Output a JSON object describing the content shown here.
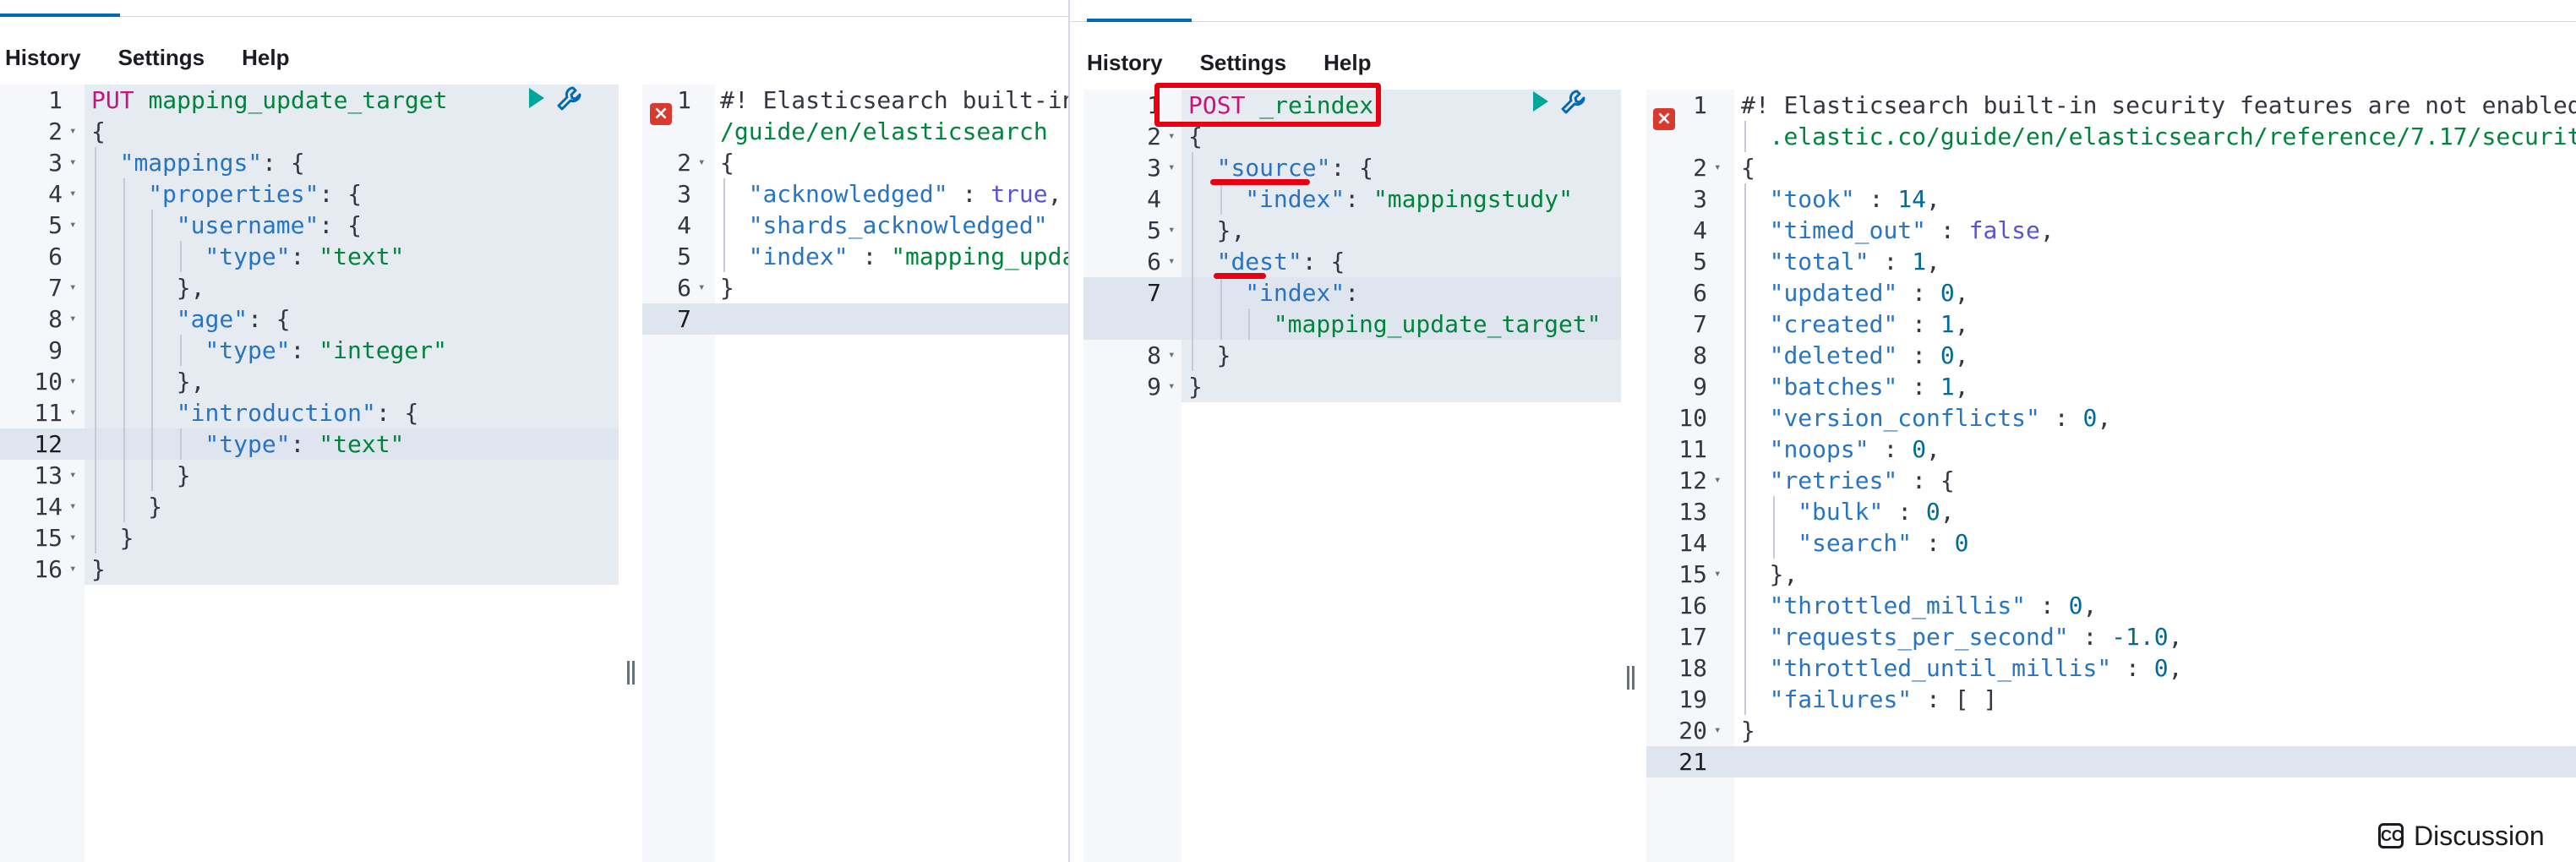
{
  "menu": {
    "history": "History",
    "settings": "Settings",
    "help": "Help"
  },
  "left_request": {
    "lines": [
      {
        "n": "1",
        "fold": false,
        "indent": 0,
        "html": [
          [
            "m",
            "PUT "
          ],
          [
            "u",
            "mapping_update_target"
          ]
        ]
      },
      {
        "n": "2",
        "fold": true,
        "indent": 0,
        "html": [
          [
            "p",
            "{"
          ]
        ]
      },
      {
        "n": "3",
        "fold": true,
        "indent": 1,
        "html": [
          [
            "k",
            "\"mappings\""
          ],
          [
            "p",
            ": {"
          ]
        ]
      },
      {
        "n": "4",
        "fold": true,
        "indent": 2,
        "html": [
          [
            "k",
            "\"properties\""
          ],
          [
            "p",
            ": {"
          ]
        ]
      },
      {
        "n": "5",
        "fold": true,
        "indent": 3,
        "html": [
          [
            "k",
            "\"username\""
          ],
          [
            "p",
            ": {"
          ]
        ]
      },
      {
        "n": "6",
        "fold": false,
        "indent": 4,
        "html": [
          [
            "k",
            "\"type\""
          ],
          [
            "p",
            ": "
          ],
          [
            "s",
            "\"text\""
          ]
        ]
      },
      {
        "n": "7",
        "fold": true,
        "indent": 3,
        "html": [
          [
            "p",
            "},"
          ]
        ]
      },
      {
        "n": "8",
        "fold": true,
        "indent": 3,
        "html": [
          [
            "k",
            "\"age\""
          ],
          [
            "p",
            ": {"
          ]
        ]
      },
      {
        "n": "9",
        "fold": false,
        "indent": 4,
        "html": [
          [
            "k",
            "\"type\""
          ],
          [
            "p",
            ": "
          ],
          [
            "s",
            "\"integer\""
          ]
        ]
      },
      {
        "n": "10",
        "fold": true,
        "indent": 3,
        "html": [
          [
            "p",
            "},"
          ]
        ]
      },
      {
        "n": "11",
        "fold": true,
        "indent": 3,
        "html": [
          [
            "k",
            "\"introduction\""
          ],
          [
            "p",
            ": {"
          ]
        ]
      },
      {
        "n": "12",
        "fold": false,
        "indent": 4,
        "html": [
          [
            "k",
            "\"type\""
          ],
          [
            "p",
            ": "
          ],
          [
            "s",
            "\"text\""
          ]
        ],
        "active": true
      },
      {
        "n": "13",
        "fold": true,
        "indent": 3,
        "html": [
          [
            "p",
            "}"
          ]
        ]
      },
      {
        "n": "14",
        "fold": true,
        "indent": 2,
        "html": [
          [
            "p",
            "}"
          ]
        ]
      },
      {
        "n": "15",
        "fold": true,
        "indent": 1,
        "html": [
          [
            "p",
            "}"
          ]
        ]
      },
      {
        "n": "16",
        "fold": true,
        "indent": 0,
        "html": [
          [
            "p",
            "}"
          ]
        ]
      }
    ]
  },
  "left_response": {
    "lines": [
      {
        "n": "1",
        "fold": false,
        "indent": 0,
        "html": [
          [
            "c",
            "#! Elasticsearch built-in"
          ]
        ]
      },
      {
        "n": "",
        "fold": false,
        "indent": 0,
        "html": [
          [
            "u",
            "/guide/en/elasticsearch"
          ]
        ]
      },
      {
        "n": "2",
        "fold": true,
        "indent": 0,
        "html": [
          [
            "p",
            "{"
          ]
        ]
      },
      {
        "n": "3",
        "fold": false,
        "indent": 1,
        "html": [
          [
            "k",
            "\"acknowledged\""
          ],
          [
            "p",
            " : "
          ],
          [
            "b",
            "true"
          ],
          [
            "p",
            ","
          ]
        ]
      },
      {
        "n": "4",
        "fold": false,
        "indent": 1,
        "html": [
          [
            "k",
            "\"shards_acknowledged\""
          ]
        ]
      },
      {
        "n": "5",
        "fold": false,
        "indent": 1,
        "html": [
          [
            "k",
            "\"index\""
          ],
          [
            "p",
            " : "
          ],
          [
            "s",
            "\"mapping_upda"
          ]
        ]
      },
      {
        "n": "6",
        "fold": true,
        "indent": 0,
        "html": [
          [
            "p",
            "}"
          ]
        ]
      },
      {
        "n": "7",
        "fold": false,
        "indent": 0,
        "html": [
          [
            "p",
            ""
          ]
        ],
        "active": true
      }
    ]
  },
  "right_request": {
    "lines": [
      {
        "n": "1",
        "fold": false,
        "indent": 0,
        "html": [
          [
            "m",
            "POST "
          ],
          [
            "u",
            "_reindex"
          ]
        ]
      },
      {
        "n": "2",
        "fold": true,
        "indent": 0,
        "html": [
          [
            "p",
            "{"
          ]
        ]
      },
      {
        "n": "3",
        "fold": true,
        "indent": 1,
        "html": [
          [
            "k",
            "\"source\""
          ],
          [
            "p",
            ": {"
          ]
        ]
      },
      {
        "n": "4",
        "fold": false,
        "indent": 2,
        "html": [
          [
            "k",
            "\"index\""
          ],
          [
            "p",
            ": "
          ],
          [
            "s",
            "\"mappingstudy\""
          ]
        ]
      },
      {
        "n": "5",
        "fold": true,
        "indent": 1,
        "html": [
          [
            "p",
            "},"
          ]
        ]
      },
      {
        "n": "6",
        "fold": true,
        "indent": 1,
        "html": [
          [
            "k",
            "\"dest\""
          ],
          [
            "p",
            ": {"
          ]
        ]
      },
      {
        "n": "7",
        "fold": false,
        "indent": 2,
        "html": [
          [
            "k",
            "\"index\""
          ],
          [
            "p",
            ":"
          ]
        ],
        "active": true
      },
      {
        "n": "",
        "fold": false,
        "indent": 3,
        "html": [
          [
            "s",
            "\"mapping_update_target\""
          ]
        ],
        "active": true
      },
      {
        "n": "8",
        "fold": true,
        "indent": 1,
        "html": [
          [
            "p",
            "}"
          ]
        ]
      },
      {
        "n": "9",
        "fold": true,
        "indent": 0,
        "html": [
          [
            "p",
            "}"
          ]
        ]
      }
    ]
  },
  "right_response": {
    "lines": [
      {
        "n": "1",
        "fold": false,
        "indent": 0,
        "html": [
          [
            "c",
            "#! Elasticsearch built-in security features are not enabled"
          ]
        ]
      },
      {
        "n": "",
        "fold": false,
        "indent": 1,
        "html": [
          [
            "u",
            ".elastic.co/guide/en/elasticsearch/reference/7.17/securit"
          ]
        ]
      },
      {
        "n": "2",
        "fold": true,
        "indent": 0,
        "html": [
          [
            "p",
            "{"
          ]
        ]
      },
      {
        "n": "3",
        "fold": false,
        "indent": 1,
        "html": [
          [
            "k",
            "\"took\""
          ],
          [
            "p",
            " : "
          ],
          [
            "n",
            "14"
          ],
          [
            "p",
            ","
          ]
        ]
      },
      {
        "n": "4",
        "fold": false,
        "indent": 1,
        "html": [
          [
            "k",
            "\"timed_out\""
          ],
          [
            "p",
            " : "
          ],
          [
            "b",
            "false"
          ],
          [
            "p",
            ","
          ]
        ]
      },
      {
        "n": "5",
        "fold": false,
        "indent": 1,
        "html": [
          [
            "k",
            "\"total\""
          ],
          [
            "p",
            " : "
          ],
          [
            "n",
            "1"
          ],
          [
            "p",
            ","
          ]
        ]
      },
      {
        "n": "6",
        "fold": false,
        "indent": 1,
        "html": [
          [
            "k",
            "\"updated\""
          ],
          [
            "p",
            " : "
          ],
          [
            "n",
            "0"
          ],
          [
            "p",
            ","
          ]
        ]
      },
      {
        "n": "7",
        "fold": false,
        "indent": 1,
        "html": [
          [
            "k",
            "\"created\""
          ],
          [
            "p",
            " : "
          ],
          [
            "n",
            "1"
          ],
          [
            "p",
            ","
          ]
        ]
      },
      {
        "n": "8",
        "fold": false,
        "indent": 1,
        "html": [
          [
            "k",
            "\"deleted\""
          ],
          [
            "p",
            " : "
          ],
          [
            "n",
            "0"
          ],
          [
            "p",
            ","
          ]
        ]
      },
      {
        "n": "9",
        "fold": false,
        "indent": 1,
        "html": [
          [
            "k",
            "\"batches\""
          ],
          [
            "p",
            " : "
          ],
          [
            "n",
            "1"
          ],
          [
            "p",
            ","
          ]
        ]
      },
      {
        "n": "10",
        "fold": false,
        "indent": 1,
        "html": [
          [
            "k",
            "\"version_conflicts\""
          ],
          [
            "p",
            " : "
          ],
          [
            "n",
            "0"
          ],
          [
            "p",
            ","
          ]
        ]
      },
      {
        "n": "11",
        "fold": false,
        "indent": 1,
        "html": [
          [
            "k",
            "\"noops\""
          ],
          [
            "p",
            " : "
          ],
          [
            "n",
            "0"
          ],
          [
            "p",
            ","
          ]
        ]
      },
      {
        "n": "12",
        "fold": true,
        "indent": 1,
        "html": [
          [
            "k",
            "\"retries\""
          ],
          [
            "p",
            " : {"
          ]
        ]
      },
      {
        "n": "13",
        "fold": false,
        "indent": 2,
        "html": [
          [
            "k",
            "\"bulk\""
          ],
          [
            "p",
            " : "
          ],
          [
            "n",
            "0"
          ],
          [
            "p",
            ","
          ]
        ]
      },
      {
        "n": "14",
        "fold": false,
        "indent": 2,
        "html": [
          [
            "k",
            "\"search\""
          ],
          [
            "p",
            " : "
          ],
          [
            "n",
            "0"
          ]
        ]
      },
      {
        "n": "15",
        "fold": true,
        "indent": 1,
        "html": [
          [
            "p",
            "},"
          ]
        ]
      },
      {
        "n": "16",
        "fold": false,
        "indent": 1,
        "html": [
          [
            "k",
            "\"throttled_millis\""
          ],
          [
            "p",
            " : "
          ],
          [
            "n",
            "0"
          ],
          [
            "p",
            ","
          ]
        ]
      },
      {
        "n": "17",
        "fold": false,
        "indent": 1,
        "html": [
          [
            "k",
            "\"requests_per_second\""
          ],
          [
            "p",
            " : "
          ],
          [
            "n",
            "-1.0"
          ],
          [
            "p",
            ","
          ]
        ]
      },
      {
        "n": "18",
        "fold": false,
        "indent": 1,
        "html": [
          [
            "k",
            "\"throttled_until_millis\""
          ],
          [
            "p",
            " : "
          ],
          [
            "n",
            "0"
          ],
          [
            "p",
            ","
          ]
        ]
      },
      {
        "n": "19",
        "fold": false,
        "indent": 1,
        "html": [
          [
            "k",
            "\"failures\""
          ],
          [
            "p",
            " : [ ]"
          ]
        ]
      },
      {
        "n": "20",
        "fold": true,
        "indent": 0,
        "html": [
          [
            "p",
            "}"
          ]
        ]
      },
      {
        "n": "21",
        "fold": false,
        "indent": 0,
        "html": [
          [
            "p",
            ""
          ]
        ],
        "active": true
      }
    ]
  },
  "discussion": {
    "icon": "CC",
    "label": "Discussion"
  },
  "colors": {
    "accent": "#006bb4",
    "highlight": "#e60012",
    "play": "#00a69b",
    "error": "#d93a2f"
  }
}
